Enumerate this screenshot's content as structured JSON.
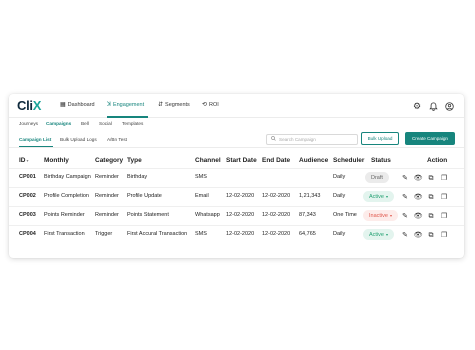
{
  "app": {
    "logo_main": "Cli",
    "logo_accent": "X"
  },
  "nav": {
    "items": [
      {
        "label": "Dashboard",
        "icon": "dashboard-icon"
      },
      {
        "label": "Engagement",
        "icon": "engagement-icon"
      },
      {
        "label": "Segments",
        "icon": "segments-icon"
      },
      {
        "label": "ROI",
        "icon": "roi-icon"
      }
    ],
    "active": "Engagement",
    "right_icons": [
      "gear-icon",
      "bell-icon",
      "user-icon"
    ]
  },
  "subtabs": [
    "Journeys",
    "Campaigns",
    "Bell",
    "Social",
    "Templates"
  ],
  "subtab_active": "Campaigns",
  "content_tabs": [
    "Campaign List",
    "Bulk Upload Logs",
    "A/Bn Test"
  ],
  "content_tab_active": "Campaign List",
  "search": {
    "placeholder": "Search Campaign",
    "value": ""
  },
  "buttons": {
    "bulk_upload": "Bulk Upload",
    "create_campaign": "Create Campaign"
  },
  "table": {
    "columns": [
      "ID",
      "Monthly",
      "Category",
      "Type",
      "Channel",
      "Start Date",
      "End Date",
      "Audience",
      "Scheduler",
      "Status",
      "Action"
    ],
    "rows": [
      {
        "id": "CP001",
        "monthly": "Birthday Campaign",
        "category": "Reminder",
        "type": "Birthday",
        "channel": "SMS",
        "start": "",
        "end": "",
        "audience": "",
        "scheduler": "Daily",
        "status": "Draft",
        "status_kind": "draft"
      },
      {
        "id": "CP002",
        "monthly": "Profile Completion",
        "category": "Reminder",
        "type": "Profile Update",
        "channel": "Email",
        "start": "12-02-2020",
        "end": "12-02-2020",
        "audience": "1,21,343",
        "scheduler": "Daily",
        "status": "Active",
        "status_kind": "active"
      },
      {
        "id": "CP003",
        "monthly": "Points Reminder",
        "category": "Reminder",
        "type": "Points Statement",
        "channel": "Whatsapp",
        "start": "12-02-2020",
        "end": "12-02-2020",
        "audience": "87,343",
        "scheduler": "One Time",
        "status": "Inactive",
        "status_kind": "inactive"
      },
      {
        "id": "CP004",
        "monthly": "First Transaction",
        "category": "Trigger",
        "type": "First Accural Transaction",
        "channel": "SMS",
        "start": "12-02-2020",
        "end": "12-02-2020",
        "audience": "64,765",
        "scheduler": "Daily",
        "status": "Active",
        "status_kind": "active"
      }
    ],
    "row_actions": [
      "edit-icon",
      "view-icon",
      "copy-icon",
      "duplicate-icon"
    ]
  },
  "colors": {
    "brand": "#17857d",
    "logo_dark": "#0f2a3d",
    "active_badge": "#23a172",
    "inactive_badge": "#e0574c"
  }
}
